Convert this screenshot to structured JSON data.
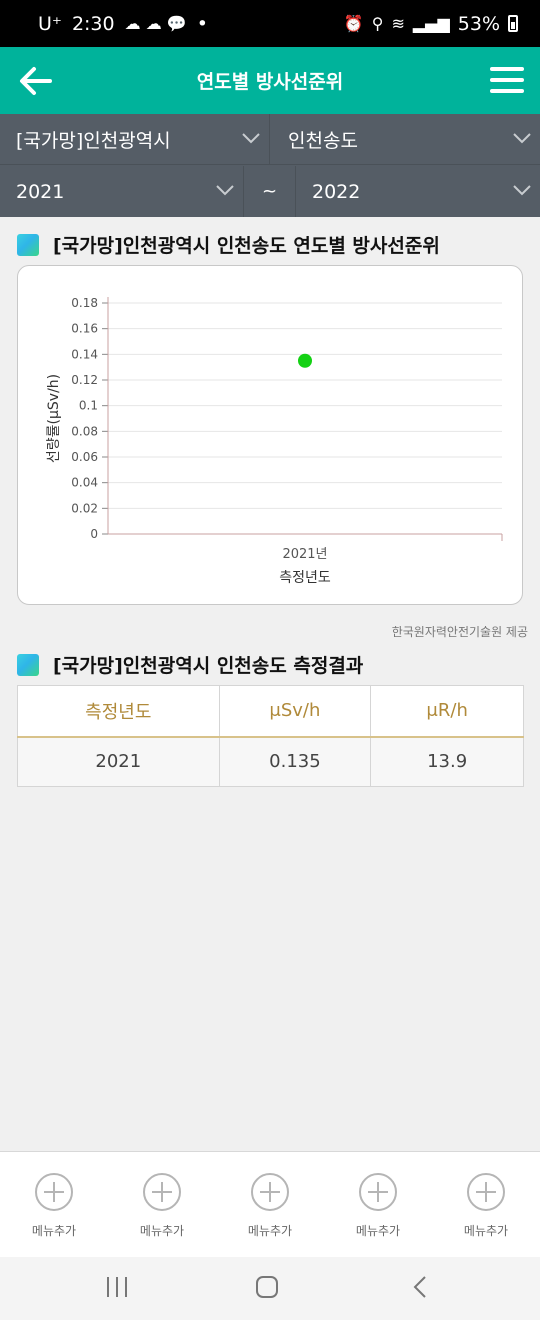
{
  "status_bar": {
    "carrier": "U⁺",
    "time": "2:30",
    "dot": "•",
    "battery": "53%"
  },
  "header": {
    "title": "연도별 방사선준위"
  },
  "filters": {
    "region": "[국가망]인천광역시",
    "station": "인천송도",
    "year_from": "2021",
    "separator": "~",
    "year_to": "2022"
  },
  "chart_section": {
    "title": "[국가망]인천광역시 인천송도 연도별 방사선준위"
  },
  "chart_data": {
    "type": "scatter",
    "title": "",
    "xlabel": "측정년도",
    "ylabel": "선량률(μSv/h)",
    "categories": [
      "2021년"
    ],
    "series": [
      {
        "values": [
          0.135
        ],
        "color": "#14d114"
      }
    ],
    "yticks": [
      "0",
      "0.02",
      "0.04",
      "0.06",
      "0.08",
      "0.1",
      "0.12",
      "0.14",
      "0.16",
      "0.18"
    ],
    "ylim": [
      0,
      0.18
    ],
    "grid": true
  },
  "credit": "한국원자력안전기술원 제공",
  "result_section": {
    "title": "[국가망]인천광역시 인천송도 측정결과"
  },
  "table": {
    "headers": [
      "측정년도",
      "μSv/h",
      "μR/h"
    ],
    "rows": [
      [
        "2021",
        "0.135",
        "13.9"
      ]
    ]
  },
  "bottom_menu": {
    "items": [
      {
        "label": "메뉴추가"
      },
      {
        "label": "메뉴추가"
      },
      {
        "label": "메뉴추가"
      },
      {
        "label": "메뉴추가"
      },
      {
        "label": "메뉴추가"
      }
    ]
  },
  "colors": {
    "accent": "#00b39b",
    "filter_bg": "#555d66",
    "point": "#14d114",
    "header_text": "#b08a3a"
  }
}
